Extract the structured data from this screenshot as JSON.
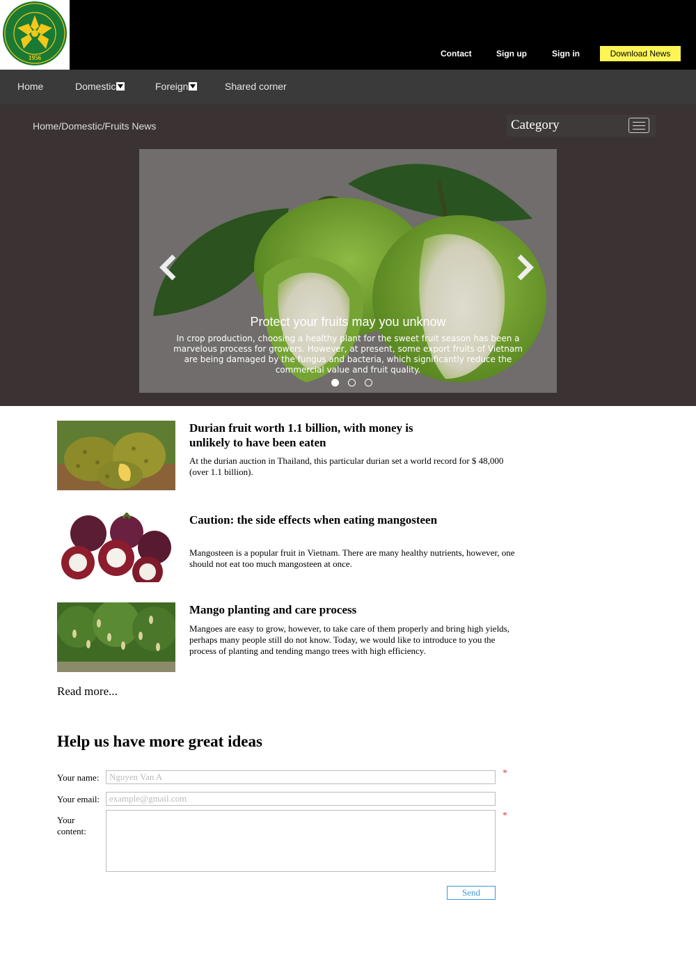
{
  "header": {
    "logo_text": "HỌC VIỆN NÔNG NGHIỆP VIỆT NAM 1956",
    "links": [
      "Contact",
      "Sign up",
      "Sign in"
    ],
    "download_label": "Download News"
  },
  "nav": {
    "items": [
      "Home",
      "Domestic",
      "Foreign",
      "Shared corner"
    ]
  },
  "breadcrumb": "Home/Domestic/Fruits News",
  "category_label": "Category",
  "carousel": {
    "caption_title": "Protect your fruits may you unknow",
    "caption_text": "In crop production, choosing a healthy plant for the sweet fruit season has been a marvelous process for growers. However, at present, some export fruits of Vietnam are being damaged by the fungus and bacteria, which significantly reduce the commercial value and fruit quality.",
    "active_slide": 1,
    "slide_count": 3
  },
  "articles": [
    {
      "title": "Durian fruit worth 1.1 billion, with money is unlikely to have been eaten",
      "desc": "At the durian auction in Thailand, this particular durian set a world record for $ 48,000 (over 1.1 billion)."
    },
    {
      "title": "Caution: the side effects when eating mangosteen",
      "desc": "Mangosteen is a popular fruit in Vietnam. There are many healthy nutrients, however, one should not eat too much mangosteen at once."
    },
    {
      "title": "Mango planting and care process",
      "desc": "Mangoes are easy to grow, however, to take care of them properly and bring high yields, perhaps many people still do not know. Today, we would like to introduce to you the process of planting and tending mango trees with high efficiency."
    }
  ],
  "read_more": "Read more...",
  "form": {
    "title": "Help us have more great ideas",
    "name_label": "Your name:",
    "name_placeholder": "Nguyen Van A",
    "email_label": "Your email:",
    "email_placeholder": "example@gmail.com",
    "content_label_1": "Your",
    "content_label_2": "content:",
    "required_mark": "*",
    "send_label": "Send"
  },
  "colors": {
    "header_bg": "#000000",
    "nav_bg": "#3a3a3a",
    "band_bg": "#3b3333",
    "download_bg": "#fdf556",
    "send_accent": "#3c97d6",
    "required": "#e03b3b"
  }
}
